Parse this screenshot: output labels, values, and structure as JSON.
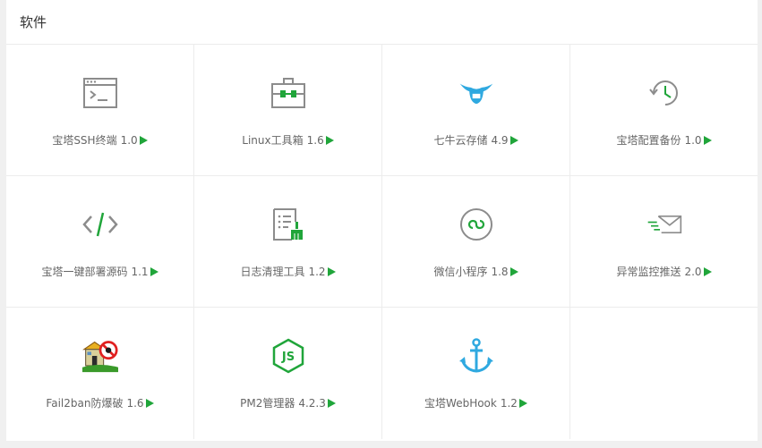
{
  "panel": {
    "title": "软件"
  },
  "colors": {
    "accent": "#20a53a",
    "icon_gray": "#8c8c8c",
    "icon_blue": "#2fa9e0"
  },
  "items": [
    {
      "name": "宝塔SSH终端",
      "version": "1.0",
      "icon": "terminal-icon"
    },
    {
      "name": "Linux工具箱",
      "version": "1.6",
      "icon": "toolbox-icon"
    },
    {
      "name": "七牛云存储",
      "version": "4.9",
      "icon": "qiniu-cloud-icon"
    },
    {
      "name": "宝塔配置备份",
      "version": "1.0",
      "icon": "backup-history-icon"
    },
    {
      "name": "宝塔一键部署源码",
      "version": "1.1",
      "icon": "code-icon"
    },
    {
      "name": "日志清理工具",
      "version": "1.2",
      "icon": "log-clean-icon"
    },
    {
      "name": "微信小程序",
      "version": "1.8",
      "icon": "wechat-miniprogram-icon"
    },
    {
      "name": "异常监控推送",
      "version": "2.0",
      "icon": "mail-push-icon"
    },
    {
      "name": "Fail2ban防爆破",
      "version": "1.6",
      "icon": "fail2ban-icon"
    },
    {
      "name": "PM2管理器",
      "version": "4.2.3",
      "icon": "nodejs-icon"
    },
    {
      "name": "宝塔WebHook",
      "version": "1.2",
      "icon": "anchor-icon"
    }
  ]
}
